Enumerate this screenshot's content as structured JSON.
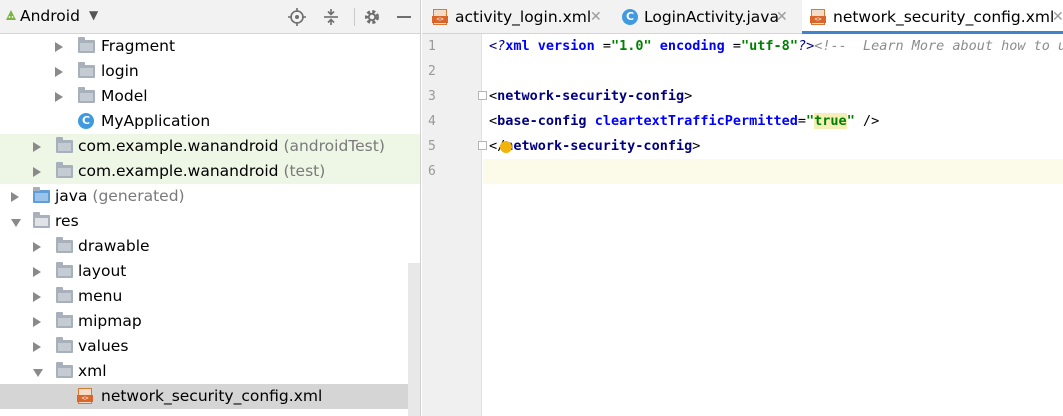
{
  "project": {
    "view_label": "Android",
    "tools": [
      "locate-icon",
      "collapse-all-icon",
      "settings-icon",
      "minimize-icon"
    ],
    "tree": [
      {
        "label": "Fragment",
        "sub": "",
        "icon": "folder-icon",
        "arrow": "right",
        "level": 3,
        "style": ""
      },
      {
        "label": "login",
        "sub": "",
        "icon": "folder-icon",
        "arrow": "right",
        "level": 3,
        "style": ""
      },
      {
        "label": "Model",
        "sub": "",
        "icon": "folder-icon",
        "arrow": "right",
        "level": 3,
        "style": ""
      },
      {
        "label": "MyApplication",
        "sub": "",
        "icon": "class-icon",
        "arrow": "",
        "level": 3,
        "style": ""
      },
      {
        "label": "com.example.wanandroid",
        "sub": "(androidTest)",
        "icon": "folder-icon",
        "arrow": "right",
        "level": 2,
        "style": "test"
      },
      {
        "label": "com.example.wanandroid",
        "sub": "(test)",
        "icon": "folder-icon",
        "arrow": "right",
        "level": 2,
        "style": "test"
      },
      {
        "label": "java",
        "sub": "(generated)",
        "icon": "java-folder-icon",
        "arrow": "right",
        "level": 1,
        "style": ""
      },
      {
        "label": "res",
        "sub": "",
        "icon": "res-folder-icon",
        "arrow": "down",
        "level": 1,
        "style": ""
      },
      {
        "label": "drawable",
        "sub": "",
        "icon": "folder-icon",
        "arrow": "right",
        "level": 2,
        "style": ""
      },
      {
        "label": "layout",
        "sub": "",
        "icon": "folder-icon",
        "arrow": "right",
        "level": 2,
        "style": ""
      },
      {
        "label": "menu",
        "sub": "",
        "icon": "folder-icon",
        "arrow": "right",
        "level": 2,
        "style": ""
      },
      {
        "label": "mipmap",
        "sub": "",
        "icon": "folder-icon",
        "arrow": "right",
        "level": 2,
        "style": ""
      },
      {
        "label": "values",
        "sub": "",
        "icon": "folder-icon",
        "arrow": "right",
        "level": 2,
        "style": ""
      },
      {
        "label": "xml",
        "sub": "",
        "icon": "folder-icon",
        "arrow": "down",
        "level": 2,
        "style": ""
      },
      {
        "label": "network_security_config.xml",
        "sub": "",
        "icon": "xml-file-icon",
        "arrow": "",
        "level": 3,
        "style": "selected"
      }
    ]
  },
  "editor": {
    "tabs": [
      {
        "label": "activity_login.xml",
        "icon": "xml-file-icon",
        "active": false
      },
      {
        "label": "LoginActivity.java",
        "icon": "class-icon",
        "active": false
      },
      {
        "label": "network_security_config.xml",
        "icon": "xml-file-icon",
        "active": true
      }
    ],
    "line_numbers": [
      "1",
      "2",
      "3",
      "4",
      "5",
      "6"
    ],
    "code": {
      "line1": {
        "pi_open": "<?",
        "xml": "xml",
        "a1": "version",
        "eq1": " =",
        "v1": "\"1.0\"",
        "a2": "encoding",
        "eq2": " =",
        "v2": "\"utf-8\"",
        "pi_close": "?>",
        "comment": "<!--  Learn More about how to use App Actions: https://developer.android.com/guide/actions/index.html -->"
      },
      "line3": {
        "open": "<",
        "tag": "network-security-config",
        "close": ">"
      },
      "line4": {
        "open": "<",
        "tag": "base-config",
        "attr": "cleartextTrafficPermitted",
        "eq": "=",
        "q1": "\"",
        "val": "true",
        "q2": "\"",
        "close": " />"
      },
      "line5": {
        "open": "</",
        "tag": "network-security-config",
        "close": ">"
      }
    },
    "current_line": 6
  },
  "colors": {
    "accent": "#4083c9",
    "test_row": "#eef6e6",
    "selected_row": "#d5d5d5",
    "xml_tag": "#000080",
    "xml_value": "#008000"
  }
}
